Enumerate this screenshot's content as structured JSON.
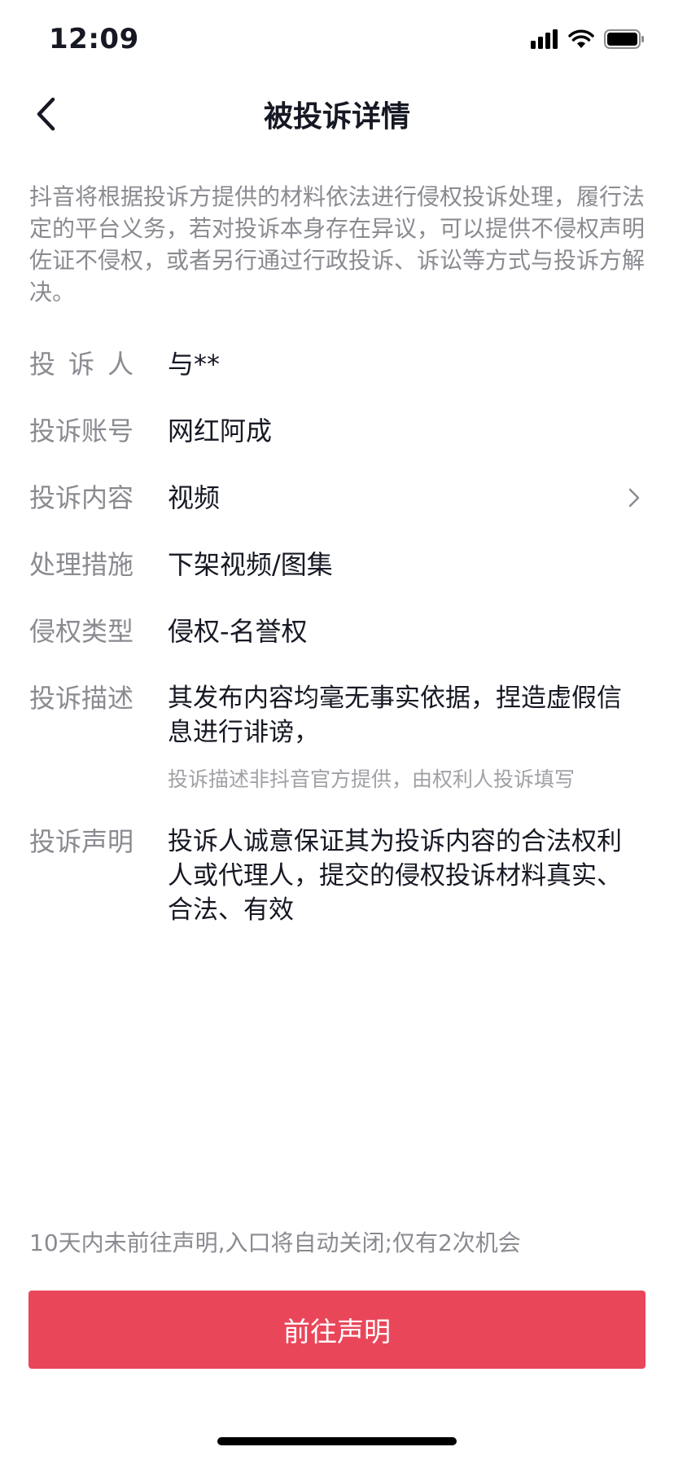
{
  "status_bar": {
    "time": "12:09",
    "icons": [
      "cellular-signal-icon",
      "wifi-icon",
      "battery-icon"
    ]
  },
  "nav": {
    "back_icon": "chevron-left-icon",
    "title": "被投诉详情"
  },
  "notice": "抖音将根据投诉方提供的材料依法进行侵权投诉处理，履行法定的平台义务，若对投诉本身存在异议，可以提供不侵权声明佐证不侵权，或者另行通过行政投诉、诉讼等方式与投诉方解决。",
  "details": {
    "complainant": {
      "label": "投诉人",
      "value": "与**"
    },
    "account": {
      "label": "投诉账号",
      "value": "网红阿成"
    },
    "content": {
      "label": "投诉内容",
      "value": "视频",
      "icon": "chevron-right-icon"
    },
    "measure": {
      "label": "处理措施",
      "value": "下架视频/图集"
    },
    "type": {
      "label": "侵权类型",
      "value": "侵权-名誉权"
    },
    "description": {
      "label": "投诉描述",
      "value": "其发布内容均毫无事实依据，捏造虚假信息进行诽谤，",
      "hint": "投诉描述非抖音官方提供，由权利人投诉填写"
    },
    "statement": {
      "label": "投诉声明",
      "value": "投诉人诚意保证其为投诉内容的合法权利人或代理人，提交的侵权投诉材料真实、合法、有效"
    }
  },
  "footer": {
    "note": "10天内未前往声明,入口将自动关闭;仅有2次机会",
    "button_label": "前往声明"
  },
  "colors": {
    "accent": "#ea465a",
    "primary_text": "#161823",
    "secondary_text": "#8a8b91"
  }
}
